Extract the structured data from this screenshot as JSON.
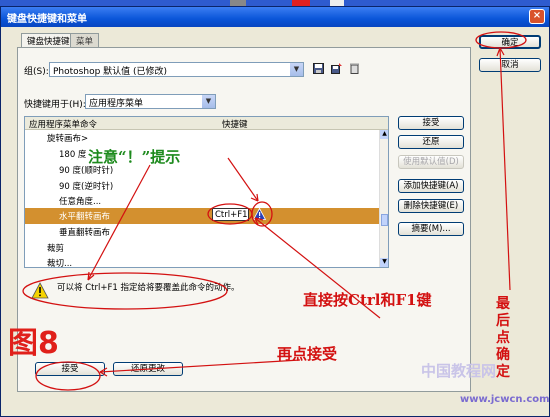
{
  "window": {
    "title": "键盘快捷键和菜单",
    "close_glyph": "×"
  },
  "tabs": [
    {
      "label": "键盘快捷键"
    },
    {
      "label": "菜单"
    }
  ],
  "set": {
    "label": "组(S):",
    "value": "Photoshop 默认值 (已修改)"
  },
  "shortcuts_for": {
    "label": "快捷键用于(H):",
    "value": "应用程序菜单"
  },
  "list": {
    "headers": {
      "command": "应用程序菜单命令",
      "shortcut": "快捷键"
    },
    "rows": [
      {
        "command": "旋转画布>",
        "shortcut": ""
      },
      {
        "command": "180 度",
        "shortcut": ""
      },
      {
        "command": "90 度(顺时针)",
        "shortcut": ""
      },
      {
        "command": "90 度(逆时针)",
        "shortcut": ""
      },
      {
        "command": "任意角度...",
        "shortcut": ""
      },
      {
        "command": "水平翻转画布",
        "shortcut": "Ctrl+F1"
      },
      {
        "command": "垂直翻转画布",
        "shortcut": ""
      },
      {
        "command": "裁剪",
        "shortcut": ""
      },
      {
        "command": "裁切...",
        "shortcut": ""
      }
    ]
  },
  "side_buttons": [
    {
      "label": "接受",
      "enabled": true
    },
    {
      "label": "还原",
      "enabled": true
    },
    {
      "label": "使用默认值(D)",
      "enabled": false
    },
    {
      "label": "添加快捷键(A)",
      "enabled": true
    },
    {
      "label": "删除快捷键(E)",
      "enabled": true
    },
    {
      "label": "摘要(M)...",
      "enabled": true
    }
  ],
  "dialog_buttons": {
    "ok": "确定",
    "cancel": "取消"
  },
  "warning": {
    "text": "可以将 Ctrl+F1 指定给将要覆盖此命令的动作。"
  },
  "bottom_buttons": {
    "accept": "接受",
    "undo": "还原更改"
  },
  "annotations": {
    "note": "注意“！”提示",
    "direct_press": "直接按Ctrl和F1键",
    "click_accept": "再点接受",
    "last_click": [
      "最",
      "后",
      "点",
      "确",
      "定"
    ],
    "figure_label": "图8",
    "watermark_cn": "中国教程网",
    "watermark_url": "www.jcwcn.com"
  },
  "colors": {
    "annotation_red": "#d31111",
    "annotation_green": "#1d8a1d",
    "selection": "#d3902f"
  }
}
